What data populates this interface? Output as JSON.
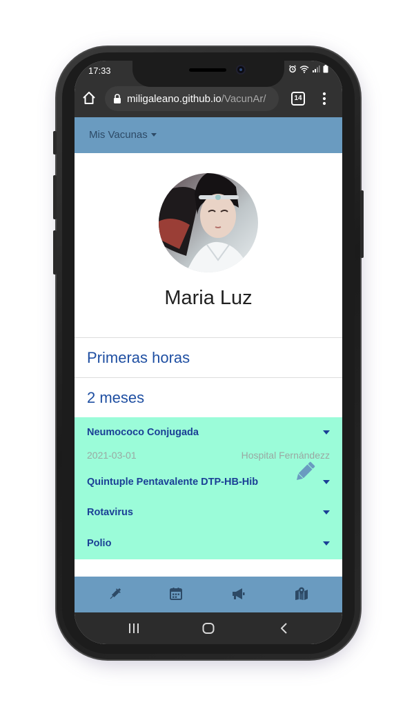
{
  "status_bar": {
    "time": "17:33"
  },
  "browser": {
    "url_domain": "miligaleano.github.io",
    "url_path": "/VacunAr/",
    "tab_count": "14"
  },
  "nav": {
    "dropdown_label": "Mis Vacunas"
  },
  "profile": {
    "name": "Maria Luz"
  },
  "sections": [
    {
      "title": "Primeras horas"
    },
    {
      "title": "2 meses"
    }
  ],
  "vaccines": [
    {
      "name": "Neumococo Conjugada",
      "date": "2021-03-01",
      "place": "Hospital Fernándezz"
    },
    {
      "name": "Quintuple Pentavalente DTP-HB-Hib"
    },
    {
      "name": "Rotavirus"
    },
    {
      "name": "Polio"
    }
  ],
  "colors": {
    "nav_bar": "#6a9bc0",
    "vaccine_panel": "#9bfcd9",
    "heading_blue": "#1f4fa2",
    "browser_chrome": "#323232"
  },
  "bottom_nav": {
    "items": [
      "syringe-icon",
      "calendar-icon",
      "megaphone-icon",
      "map-icon"
    ]
  }
}
